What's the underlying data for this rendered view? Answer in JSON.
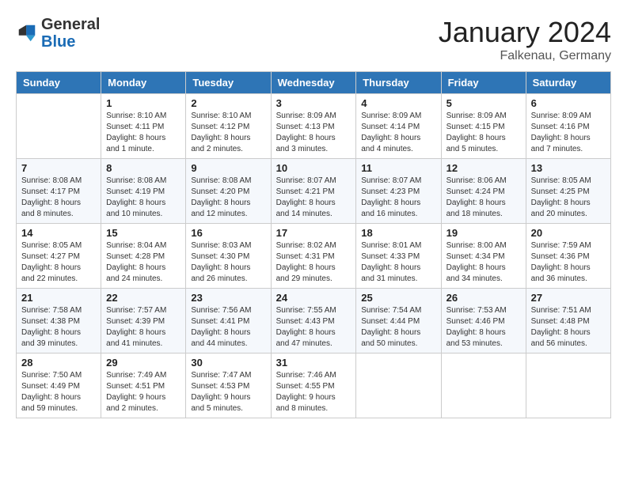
{
  "header": {
    "logo_general": "General",
    "logo_blue": "Blue",
    "month_title": "January 2024",
    "location": "Falkenau, Germany"
  },
  "calendar": {
    "days_of_week": [
      "Sunday",
      "Monday",
      "Tuesday",
      "Wednesday",
      "Thursday",
      "Friday",
      "Saturday"
    ],
    "weeks": [
      [
        {
          "day": "",
          "info": ""
        },
        {
          "day": "1",
          "info": "Sunrise: 8:10 AM\nSunset: 4:11 PM\nDaylight: 8 hours\nand 1 minute."
        },
        {
          "day": "2",
          "info": "Sunrise: 8:10 AM\nSunset: 4:12 PM\nDaylight: 8 hours\nand 2 minutes."
        },
        {
          "day": "3",
          "info": "Sunrise: 8:09 AM\nSunset: 4:13 PM\nDaylight: 8 hours\nand 3 minutes."
        },
        {
          "day": "4",
          "info": "Sunrise: 8:09 AM\nSunset: 4:14 PM\nDaylight: 8 hours\nand 4 minutes."
        },
        {
          "day": "5",
          "info": "Sunrise: 8:09 AM\nSunset: 4:15 PM\nDaylight: 8 hours\nand 5 minutes."
        },
        {
          "day": "6",
          "info": "Sunrise: 8:09 AM\nSunset: 4:16 PM\nDaylight: 8 hours\nand 7 minutes."
        }
      ],
      [
        {
          "day": "7",
          "info": "Sunrise: 8:08 AM\nSunset: 4:17 PM\nDaylight: 8 hours\nand 8 minutes."
        },
        {
          "day": "8",
          "info": "Sunrise: 8:08 AM\nSunset: 4:19 PM\nDaylight: 8 hours\nand 10 minutes."
        },
        {
          "day": "9",
          "info": "Sunrise: 8:08 AM\nSunset: 4:20 PM\nDaylight: 8 hours\nand 12 minutes."
        },
        {
          "day": "10",
          "info": "Sunrise: 8:07 AM\nSunset: 4:21 PM\nDaylight: 8 hours\nand 14 minutes."
        },
        {
          "day": "11",
          "info": "Sunrise: 8:07 AM\nSunset: 4:23 PM\nDaylight: 8 hours\nand 16 minutes."
        },
        {
          "day": "12",
          "info": "Sunrise: 8:06 AM\nSunset: 4:24 PM\nDaylight: 8 hours\nand 18 minutes."
        },
        {
          "day": "13",
          "info": "Sunrise: 8:05 AM\nSunset: 4:25 PM\nDaylight: 8 hours\nand 20 minutes."
        }
      ],
      [
        {
          "day": "14",
          "info": "Sunrise: 8:05 AM\nSunset: 4:27 PM\nDaylight: 8 hours\nand 22 minutes."
        },
        {
          "day": "15",
          "info": "Sunrise: 8:04 AM\nSunset: 4:28 PM\nDaylight: 8 hours\nand 24 minutes."
        },
        {
          "day": "16",
          "info": "Sunrise: 8:03 AM\nSunset: 4:30 PM\nDaylight: 8 hours\nand 26 minutes."
        },
        {
          "day": "17",
          "info": "Sunrise: 8:02 AM\nSunset: 4:31 PM\nDaylight: 8 hours\nand 29 minutes."
        },
        {
          "day": "18",
          "info": "Sunrise: 8:01 AM\nSunset: 4:33 PM\nDaylight: 8 hours\nand 31 minutes."
        },
        {
          "day": "19",
          "info": "Sunrise: 8:00 AM\nSunset: 4:34 PM\nDaylight: 8 hours\nand 34 minutes."
        },
        {
          "day": "20",
          "info": "Sunrise: 7:59 AM\nSunset: 4:36 PM\nDaylight: 8 hours\nand 36 minutes."
        }
      ],
      [
        {
          "day": "21",
          "info": "Sunrise: 7:58 AM\nSunset: 4:38 PM\nDaylight: 8 hours\nand 39 minutes."
        },
        {
          "day": "22",
          "info": "Sunrise: 7:57 AM\nSunset: 4:39 PM\nDaylight: 8 hours\nand 41 minutes."
        },
        {
          "day": "23",
          "info": "Sunrise: 7:56 AM\nSunset: 4:41 PM\nDaylight: 8 hours\nand 44 minutes."
        },
        {
          "day": "24",
          "info": "Sunrise: 7:55 AM\nSunset: 4:43 PM\nDaylight: 8 hours\nand 47 minutes."
        },
        {
          "day": "25",
          "info": "Sunrise: 7:54 AM\nSunset: 4:44 PM\nDaylight: 8 hours\nand 50 minutes."
        },
        {
          "day": "26",
          "info": "Sunrise: 7:53 AM\nSunset: 4:46 PM\nDaylight: 8 hours\nand 53 minutes."
        },
        {
          "day": "27",
          "info": "Sunrise: 7:51 AM\nSunset: 4:48 PM\nDaylight: 8 hours\nand 56 minutes."
        }
      ],
      [
        {
          "day": "28",
          "info": "Sunrise: 7:50 AM\nSunset: 4:49 PM\nDaylight: 8 hours\nand 59 minutes."
        },
        {
          "day": "29",
          "info": "Sunrise: 7:49 AM\nSunset: 4:51 PM\nDaylight: 9 hours\nand 2 minutes."
        },
        {
          "day": "30",
          "info": "Sunrise: 7:47 AM\nSunset: 4:53 PM\nDaylight: 9 hours\nand 5 minutes."
        },
        {
          "day": "31",
          "info": "Sunrise: 7:46 AM\nSunset: 4:55 PM\nDaylight: 9 hours\nand 8 minutes."
        },
        {
          "day": "",
          "info": ""
        },
        {
          "day": "",
          "info": ""
        },
        {
          "day": "",
          "info": ""
        }
      ]
    ]
  }
}
